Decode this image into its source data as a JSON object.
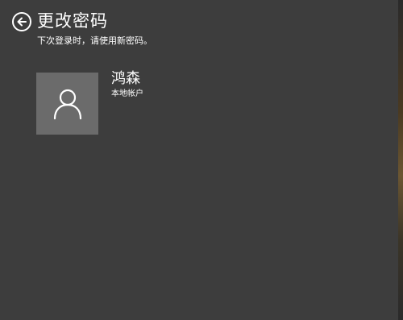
{
  "header": {
    "title": "更改密码",
    "subtitle": "下次登录时，请使用新密码。",
    "back_icon": "back-arrow-icon"
  },
  "account": {
    "name": "鸿森",
    "type": "本地帐户",
    "avatar_icon": "user-icon"
  },
  "colors": {
    "background": "#3d3d3d",
    "avatar_bg": "#6b6b6b",
    "text": "#ffffff"
  }
}
